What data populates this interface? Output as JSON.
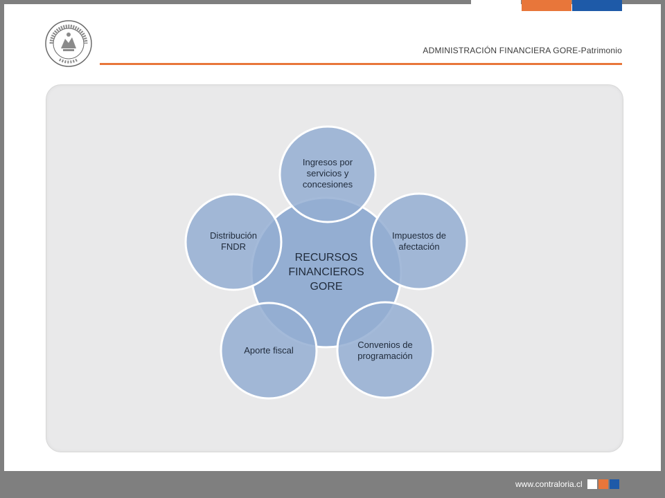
{
  "header": {
    "title": "ADMINISTRACIÓN FINANCIERA GORE-Patrimonio",
    "logo_text": [
      "CONTRALORIA GENERAL DE LA REPUBLICA",
      "CHILE"
    ]
  },
  "diagram": {
    "center": [
      "RECURSOS",
      "FINANCIEROS",
      "GORE"
    ],
    "nodes": [
      {
        "lines": [
          "Ingresos por",
          "servicios y",
          "concesiones"
        ]
      },
      {
        "lines": [
          "Impuestos de",
          "afectación"
        ]
      },
      {
        "lines": [
          "Convenios de",
          "programación"
        ]
      },
      {
        "lines": [
          "Aporte fiscal"
        ]
      },
      {
        "lines": [
          "Distribución",
          "FNDR"
        ]
      }
    ]
  },
  "footer": {
    "url": "www.contraloria.cl"
  },
  "colors": {
    "accent_orange": "#e8763a",
    "accent_blue": "#1e5aa8",
    "circle_fill": "#94aed2",
    "frame_gray": "#7f7f7f"
  }
}
